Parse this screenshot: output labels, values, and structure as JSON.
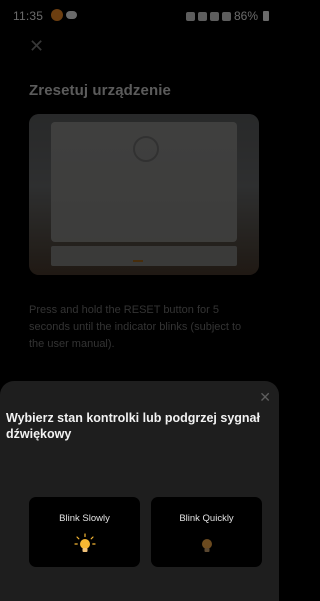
{
  "status_bar": {
    "time": "11:35",
    "battery": "86%"
  },
  "page": {
    "title": "Zresetuj urządzenie",
    "description": "Press and hold the RESET button for 5 seconds until the indicator blinks (subject to the user manual)."
  },
  "sheet": {
    "title": "Wybierz stan kontrolki lub podgrzej sygnał dźwiękowy",
    "options": [
      {
        "label": "Blink Slowly",
        "icon": "bulb-glowing-icon"
      },
      {
        "label": "Blink Quickly",
        "icon": "bulb-dim-icon"
      }
    ]
  },
  "colors": {
    "background": "#000000",
    "sheet_bg": "#1e1e1e",
    "accent_orange": "#f08a24",
    "bulb_yellow": "#f7b733"
  }
}
